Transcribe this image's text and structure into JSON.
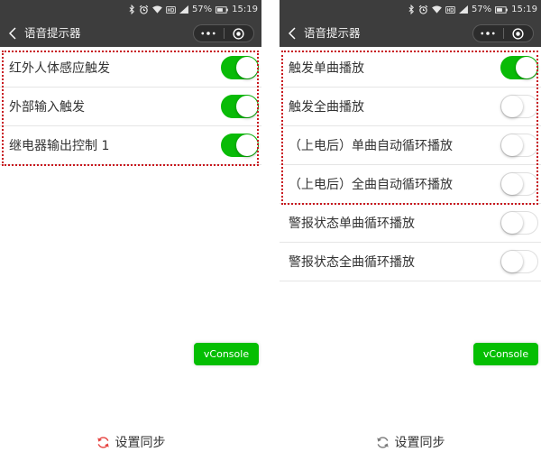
{
  "colors": {
    "header_bg": "#3d3d3d",
    "accent": "#09bb07",
    "highlight_border": "#c8161d",
    "vconsole_bg": "#04be02"
  },
  "screens": [
    {
      "status_bar": {
        "icons": [
          "bluetooth-icon",
          "alarm-icon",
          "wifi-icon",
          "hd-voice-icon",
          "signal-icon",
          "battery-icon"
        ],
        "battery_percent": "57%",
        "time": "15:19"
      },
      "nav": {
        "back_icon": "chevron-left-icon",
        "title": "语音提示器",
        "capsule_icons": [
          "more-dots-icon",
          "close-target-icon"
        ]
      },
      "highlighted_settings": [
        {
          "label": "红外人体感应触发",
          "on": true
        },
        {
          "label": "外部输入触发",
          "on": true
        },
        {
          "label": "继电器输出控制 1",
          "on": true
        }
      ],
      "vconsole_button": "vConsole",
      "sync": {
        "label": "设置同步",
        "icon": "sync-icon",
        "icon_color": "#e64340"
      }
    },
    {
      "status_bar": {
        "icons": [
          "bluetooth-icon",
          "alarm-icon",
          "wifi-icon",
          "hd-voice-icon",
          "signal-icon",
          "battery-icon"
        ],
        "battery_percent": "57%",
        "time": "15:19"
      },
      "nav": {
        "back_icon": "chevron-left-icon",
        "title": "语音提示器",
        "capsule_icons": [
          "more-dots-icon",
          "close-target-icon"
        ]
      },
      "highlighted_settings": [
        {
          "label": "触发单曲播放",
          "on": true
        },
        {
          "label": "触发全曲播放",
          "on": false
        },
        {
          "label": "（上电后）单曲自动循环播放",
          "on": false
        },
        {
          "label": "（上电后）全曲自动循环播放",
          "on": false
        }
      ],
      "settings": [
        {
          "label": "警报状态单曲循环播放",
          "on": false
        },
        {
          "label": "警报状态全曲循环播放",
          "on": false
        }
      ],
      "vconsole_button": "vConsole",
      "sync": {
        "label": "设置同步",
        "icon": "sync-icon",
        "icon_color": "#7a7a7a"
      }
    }
  ]
}
